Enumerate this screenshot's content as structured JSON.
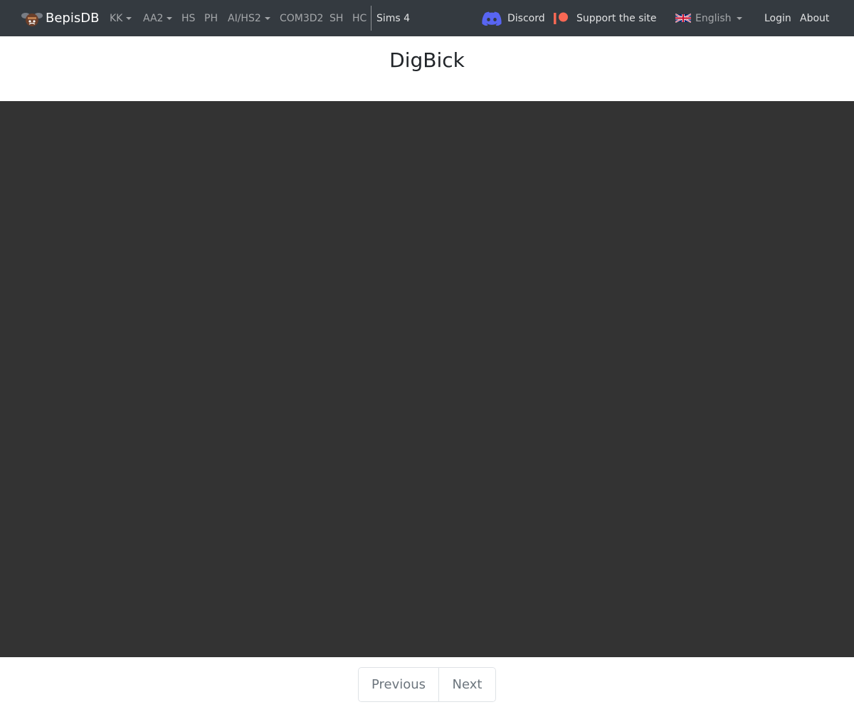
{
  "navbar": {
    "brand": "BepisDB",
    "items": [
      {
        "label": "KK",
        "dropdown": true
      },
      {
        "label": "AA2",
        "dropdown": true
      },
      {
        "label": "HS",
        "dropdown": false
      },
      {
        "label": "PH",
        "dropdown": false
      },
      {
        "label": "AI/HS2",
        "dropdown": true
      },
      {
        "label": "COM3D2",
        "dropdown": false
      },
      {
        "label": "SH",
        "dropdown": false
      },
      {
        "label": "HC",
        "dropdown": false
      },
      {
        "label": "Sims 4",
        "dropdown": false
      }
    ],
    "discord": "Discord",
    "support": "Support the site",
    "language": "English",
    "login": "Login",
    "about": "About"
  },
  "page": {
    "title": "DigBick"
  },
  "pager": {
    "previous": "Previous",
    "next": "Next"
  },
  "colors": {
    "navbar_bg": "#343a40",
    "viewer_bg": "#333333",
    "discord": "#5865F2",
    "patreon": "#F96854"
  },
  "icons": {
    "brand": "bee-logo-icon",
    "discord": "discord-icon",
    "support": "patreon-icon",
    "language": "uk-flag-icon"
  }
}
